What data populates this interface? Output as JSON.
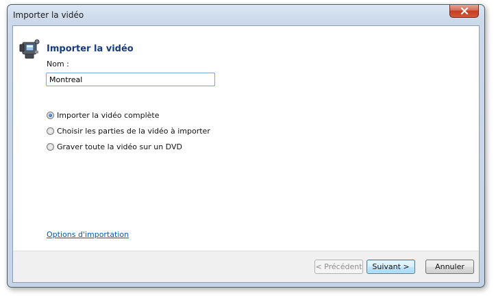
{
  "window": {
    "title": "Importer la vidéo"
  },
  "main": {
    "heading": "Importer la vidéo",
    "name_label": "Nom :",
    "name_value": "Montreal",
    "options": [
      {
        "label": "Importer la vidéo complète",
        "checked": true
      },
      {
        "label": "Choisir les parties de la vidéo à importer",
        "checked": false
      },
      {
        "label": "Graver toute la vidéo sur un DVD",
        "checked": false
      }
    ],
    "options_link": "Options d'importation"
  },
  "footer": {
    "prev_label": "< Précédent",
    "next_label": "Suivant >",
    "cancel_label": "Annuler"
  },
  "icons": {
    "close": "close-icon",
    "camera": "video-camera-icon"
  },
  "colors": {
    "heading": "#163b83",
    "link": "#0a56b5",
    "close_button": "#c43c22"
  }
}
